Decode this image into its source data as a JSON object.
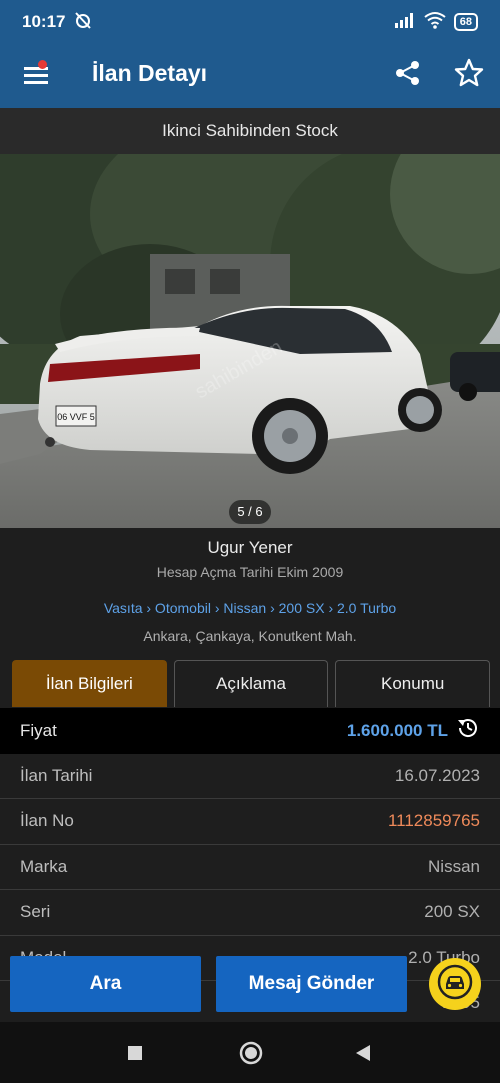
{
  "status": {
    "time": "10:17",
    "battery": "68"
  },
  "appbar": {
    "title": "İlan Detayı"
  },
  "listing": {
    "subtitle": "Ikinci Sahibinden Stock",
    "photo_counter": "5 / 6"
  },
  "seller": {
    "name": "Ugur Yener",
    "since": "Hesap Açma Tarihi  Ekim 2009"
  },
  "breadcrumb": "Vasıta › Otomobil › Nissan › 200 SX › 2.0 Turbo",
  "location": "Ankara, Çankaya, Konutkent Mah.",
  "tabs": [
    "İlan Bilgileri",
    "Açıklama",
    "Konumu"
  ],
  "details": [
    {
      "label": "Fiyat",
      "value": "1.600.000 TL"
    },
    {
      "label": "İlan Tarihi",
      "value": "16.07.2023"
    },
    {
      "label": "İlan No",
      "value": "1112859765"
    },
    {
      "label": "Marka",
      "value": "Nissan"
    },
    {
      "label": "Seri",
      "value": "200 SX"
    },
    {
      "label": "Model",
      "value": "2.0 Turbo"
    },
    {
      "label": "",
      "value": "1995"
    }
  ],
  "actions": {
    "call": "Ara",
    "message": "Mesaj Gönder"
  },
  "photo_texts": {
    "plate": "06 VVF 5",
    "watermark": "sahibinden"
  },
  "colors": {
    "brand": "#1f5a8e",
    "button": "#1565c0",
    "active_tab": "#7a4a05",
    "price": "#5ea2e8",
    "listing_no": "#ef8a5a",
    "fab": "#f5d21c"
  }
}
